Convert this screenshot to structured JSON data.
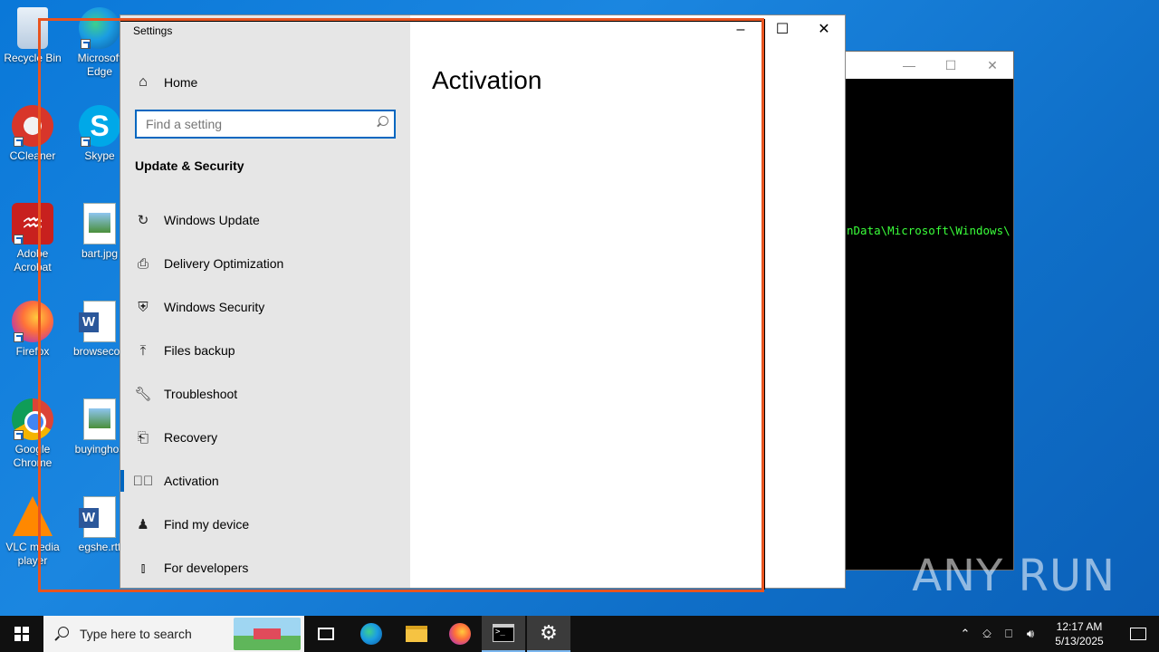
{
  "desktop": {
    "icons": [
      {
        "label": "Recycle Bin",
        "icon": "recycle-bin-icon"
      },
      {
        "label": "Microsoft Edge",
        "icon": "edge-icon"
      },
      {
        "label": "CCleaner",
        "icon": "ccleaner-icon"
      },
      {
        "label": "Skype",
        "icon": "skype-icon"
      },
      {
        "label": "Adobe Acrobat",
        "icon": "acrobat-icon"
      },
      {
        "label": "bart.jpg",
        "icon": "image-file-icon"
      },
      {
        "label": "Firefox",
        "icon": "firefox-icon"
      },
      {
        "label": "browsecop",
        "icon": "word-file-icon"
      },
      {
        "label": "Google Chrome",
        "icon": "chrome-icon"
      },
      {
        "label": "buyinghos",
        "icon": "image-file-icon"
      },
      {
        "label": "VLC media player",
        "icon": "vlc-icon"
      },
      {
        "label": "egshe.rtf",
        "icon": "word-file-icon"
      }
    ]
  },
  "cmd_window": {
    "text": "nData\\Microsoft\\Windows\\"
  },
  "settings": {
    "title": "Settings",
    "home_label": "Home",
    "search_placeholder": "Find a setting",
    "section_title": "Update & Security",
    "nav": [
      {
        "label": "Windows Update",
        "icon": "sync-icon"
      },
      {
        "label": "Delivery Optimization",
        "icon": "delivery-optimization-icon"
      },
      {
        "label": "Windows Security",
        "icon": "shield-icon"
      },
      {
        "label": "Files backup",
        "icon": "backup-arrow-icon"
      },
      {
        "label": "Troubleshoot",
        "icon": "wrench-icon"
      },
      {
        "label": "Recovery",
        "icon": "recovery-icon"
      },
      {
        "label": "Activation",
        "icon": "check-circle-icon",
        "active": true
      },
      {
        "label": "Find my device",
        "icon": "find-device-icon"
      },
      {
        "label": "For developers",
        "icon": "developer-tools-icon"
      }
    ],
    "page_heading": "Activation"
  },
  "taskbar": {
    "search_text": "Type here to search",
    "time": "12:17 AM",
    "date": "5/13/2025"
  },
  "watermark": "ANY RUN",
  "colors": {
    "accent": "#0067c0",
    "desktop": "#0a78d8",
    "selection_frame": "#e8541f",
    "console_text": "#3aff3a"
  }
}
